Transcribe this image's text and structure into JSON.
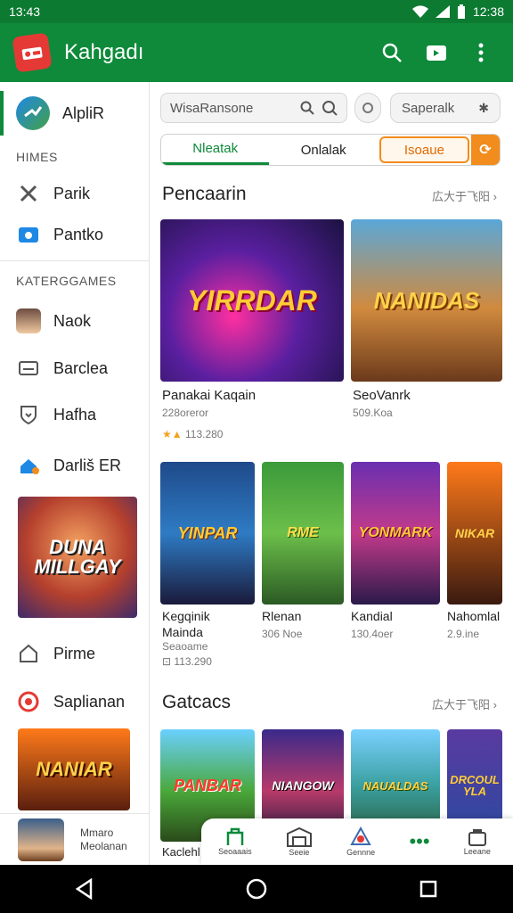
{
  "status": {
    "time_left": "13:43",
    "time_right": "12:38"
  },
  "appbar": {
    "title": "Kahgadı"
  },
  "drawer": {
    "profile_label": "AlpliR",
    "header1": "HIMES",
    "items1": [
      {
        "label": "Parik",
        "icon": "tools-icon"
      },
      {
        "label": "Pantko",
        "icon": "tv-icon"
      }
    ],
    "header2": "KATERGGAMES",
    "items2": [
      {
        "label": "Naok"
      },
      {
        "label": "Barclea"
      },
      {
        "label": "Hafha"
      },
      {
        "label": "Darliš ER"
      }
    ],
    "promo_text": "DUNA MILLGAY",
    "item_home": "Pirme",
    "item_sap": "Saplianan",
    "promo2_text": "NANIAR",
    "footer_line1": "Mmaro",
    "footer_line2": "Meolanan"
  },
  "main": {
    "search_placeholder": "WisaRansone",
    "pill_right": "Saperalk",
    "tabs": [
      "Nleatak",
      "Onlalak",
      "Isoaue"
    ],
    "section1_title": "Pencaarin",
    "section_more": "広大于飞阳 ›",
    "featured": [
      {
        "art": "YIRRDAR",
        "title": "Panakai Kaqain",
        "sub": "228oreror",
        "rating": "113.280"
      },
      {
        "art": "NANIDAS",
        "title": "SeoVanrk",
        "sub": "509.Koa",
        "rating": ""
      }
    ],
    "row2": [
      {
        "art": "YINPAR",
        "title": "Kegqinik",
        "title2": "Mainda",
        "sub": "Seaoame",
        "rating": "113.290"
      },
      {
        "art": "RME",
        "title": "Rlenan",
        "sub": "306 Noe",
        "rating": ""
      },
      {
        "art": "YONMARK",
        "title": "Kandial",
        "sub": "130.4oer",
        "rating": ""
      },
      {
        "art": "NIKAR",
        "title": "Nahomlal",
        "sub": "2.9.ine",
        "rating": ""
      }
    ],
    "section2_title": "Gatcacs",
    "row3": [
      {
        "art": "PANBAR",
        "title": "Kaclehl"
      },
      {
        "art": "NIANGOW",
        "title": ""
      },
      {
        "art": "NAUALDAS",
        "title": ""
      },
      {
        "art": "DRCOUL YLA",
        "title": ""
      }
    ]
  },
  "bottomnav": [
    {
      "label": "Seoaaais",
      "icon": "gamepad-icon"
    },
    {
      "label": "Seeie",
      "icon": "store-icon"
    },
    {
      "label": "Gennne",
      "icon": "controller-icon"
    },
    {
      "label": "",
      "icon": "more-dots-icon"
    },
    {
      "label": "Leeane",
      "icon": "library-icon"
    }
  ],
  "colors": {
    "accent": "#0e8a3a",
    "orange": "#f28c1c",
    "red": "#e53935"
  }
}
